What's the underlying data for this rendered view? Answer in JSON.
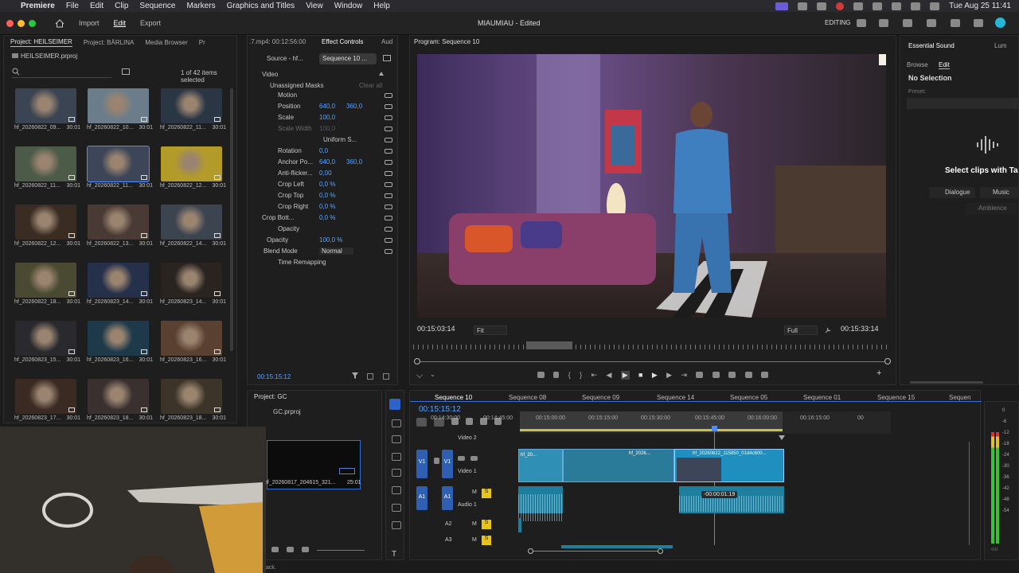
{
  "menubar": {
    "app_name": "Premiere",
    "items": [
      "File",
      "Edit",
      "Clip",
      "Sequence",
      "Markers",
      "Graphics and Titles",
      "View",
      "Window",
      "Help"
    ],
    "datetime": "Tue Aug 25  11:41"
  },
  "titlebar": {
    "workspaces": [
      "Import",
      "Edit",
      "Export"
    ],
    "active_workspace": "Edit",
    "project_title": "MIAUMIAU - Edited",
    "mode": "EDITING"
  },
  "project_panel": {
    "tabs": [
      "Project: HEILSEIMER",
      "Project: BÄRLINA",
      "Media Browser",
      "Pr"
    ],
    "file": "HEILSEIMER.prproj",
    "selection_count": "1 of 42 items selected",
    "items": [
      {
        "name": "hf_20260822_09...",
        "dur": "30:01",
        "color": "#3a4452"
      },
      {
        "name": "hf_20260822_10...",
        "dur": "30:01",
        "color": "#6b7d8a"
      },
      {
        "name": "hf_20260822_11...",
        "dur": "30:01",
        "color": "#2b3644"
      },
      {
        "name": "hf_20260822_11...",
        "dur": "30:01",
        "color": "#4c5a48"
      },
      {
        "name": "hf_20260822_11...",
        "dur": "30:01",
        "color": "#3d4658"
      },
      {
        "name": "hf_20260822_12...",
        "dur": "30:01",
        "color": "#b39b2a"
      },
      {
        "name": "hf_20260822_12...",
        "dur": "30:01",
        "color": "#3a2c22"
      },
      {
        "name": "hf_20260822_13...",
        "dur": "30:01",
        "color": "#4a3a35"
      },
      {
        "name": "hf_20260822_14...",
        "dur": "30:01",
        "color": "#3c4450"
      },
      {
        "name": "hf_20260822_18...",
        "dur": "30:01",
        "color": "#4a4a32"
      },
      {
        "name": "hf_20260823_14...",
        "dur": "30:01",
        "color": "#25304a"
      },
      {
        "name": "hf_20260823_14...",
        "dur": "30:01",
        "color": "#2a2420"
      },
      {
        "name": "hf_20260823_15...",
        "dur": "30:01",
        "color": "#2a2a2e"
      },
      {
        "name": "hf_20260823_16...",
        "dur": "30:01",
        "color": "#1e3a4a"
      },
      {
        "name": "hf_20260823_16...",
        "dur": "30:01",
        "color": "#5a4030"
      },
      {
        "name": "hf_20260823_17...",
        "dur": "30:01",
        "color": "#3a2a22"
      },
      {
        "name": "hf_20260823_18...",
        "dur": "30:01",
        "color": "#3a3030"
      },
      {
        "name": "hf_20260823_18...",
        "dur": "30:01",
        "color": "#3c3428"
      }
    ]
  },
  "source_header": ".7.mp4: 00:12:56:00",
  "effect_controls": {
    "tabs": [
      "Effect Controls",
      "Aud"
    ],
    "source_chip": "Source - hf...",
    "seq_chip": "Sequence 10 ...",
    "section_video": "Video",
    "masks": "Unassigned Masks",
    "clear_all": "Clear all",
    "rows": [
      {
        "label": "Motion",
        "v1": "",
        "v2": ""
      },
      {
        "label": "Position",
        "v1": "640,0",
        "v2": "360,0"
      },
      {
        "label": "Scale",
        "v1": "100,0",
        "v2": ""
      },
      {
        "label": "Scale Width",
        "v1": "100,0",
        "v2": ""
      },
      {
        "label": "Uniform S...",
        "v1": "",
        "v2": ""
      },
      {
        "label": "Rotation",
        "v1": "0,0",
        "v2": ""
      },
      {
        "label": "Anchor Po...",
        "v1": "640,0",
        "v2": "360,0"
      },
      {
        "label": "Anti-flicker...",
        "v1": "0,00",
        "v2": ""
      },
      {
        "label": "Crop Left",
        "v1": "0,0 %",
        "v2": ""
      },
      {
        "label": "Crop Top",
        "v1": "0,0 %",
        "v2": ""
      },
      {
        "label": "Crop Right",
        "v1": "0,0 %",
        "v2": ""
      },
      {
        "label": "Crop Bott...",
        "v1": "0,0 %",
        "v2": ""
      },
      {
        "label": "Opacity",
        "v1": "",
        "v2": ""
      },
      {
        "label": "Opacity",
        "v1": "100,0 %",
        "v2": ""
      },
      {
        "label": "Blend Mode",
        "v1": "Normal",
        "v2": ""
      },
      {
        "label": "Time Remapping",
        "v1": "",
        "v2": ""
      }
    ],
    "timecode": "00:15:15:12"
  },
  "program_monitor": {
    "title": "Program: Sequence 10",
    "timecode_left": "00:15:03:14",
    "fit": "Fit",
    "quality": "Full",
    "timecode_right": "00:15:33:14"
  },
  "essential_sound": {
    "tabs": [
      "Essential Sound",
      "Lum"
    ],
    "subtabs": [
      "Browse",
      "Edit"
    ],
    "no_selection": "No Selection",
    "preset_label": "Preset:",
    "prompt": "Select clips with Ta",
    "buttons": [
      "Dialogue",
      "Music",
      "Ambience"
    ]
  },
  "project_gc": {
    "title": "Project: GC",
    "file": "GC.prproj",
    "clip_name": "hf_20260817_204615_321...",
    "clip_dur": "25:01"
  },
  "timeline": {
    "tabs": [
      "Sequence 10",
      "Sequence 08",
      "Sequence 09",
      "Sequence 14",
      "Sequence 05",
      "Sequence 01",
      "Sequence 15",
      "Sequen"
    ],
    "timecode": "00:15:15:12",
    "ruler": [
      "00:14:30:00",
      "00:14:45:00",
      "00:15:00:00",
      "00:15:15:00",
      "00:15:30:00",
      "00:15:45:00",
      "00:16:00:00",
      "00:16:15:00",
      "00"
    ],
    "tracks": {
      "v2": "Video 2",
      "v1": "Video 1",
      "a1": "Audio 1",
      "a2": "A2",
      "a3": "A3"
    },
    "clips": [
      "hf_20...",
      "hf_2026...",
      "hf_20260822_115850_01d4c600..."
    ],
    "drag_tooltip": "-00:00:01:19",
    "meter_labels": [
      "0",
      "-6",
      "-12",
      "-18",
      "-24",
      "-30",
      "-36",
      "-42",
      "-48",
      "-54"
    ]
  },
  "status_bar": "ack."
}
